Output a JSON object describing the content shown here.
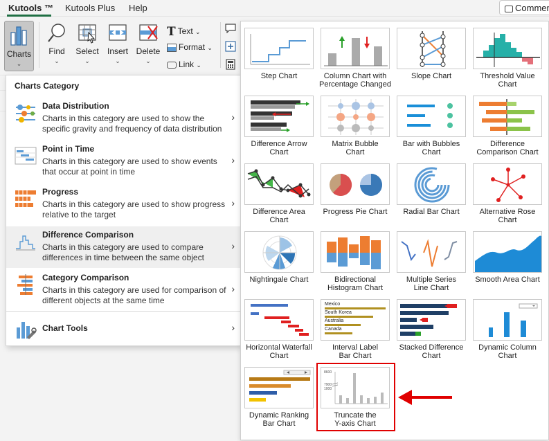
{
  "tabs": {
    "kutools": "Kutools ™",
    "kutools_plus": "Kutools Plus",
    "help": "Help",
    "comments": "Commen"
  },
  "ribbon": {
    "charts": "Charts",
    "find": "Find",
    "select": "Select",
    "insert": "Insert",
    "delete": "Delete",
    "text": "Text",
    "format": "Format",
    "link": "Link"
  },
  "category_menu": {
    "header": "Charts Category",
    "items": [
      {
        "title": "Data Distribution",
        "desc": "Charts in this category are used to show the specific gravity and frequency of data distribution"
      },
      {
        "title": "Point in Time",
        "desc": "Charts in this category are used to show events that occur at point in time"
      },
      {
        "title": "Progress",
        "desc": "Charts in this category are used to show progress relative to the target"
      },
      {
        "title": "Difference Comparison",
        "desc": "Charts in this category are used to compare differences in time between the same object"
      },
      {
        "title": "Category Comparison",
        "desc": "Charts in this category are used for comparison of different objects at the same time"
      },
      {
        "title": "Chart Tools",
        "desc": ""
      }
    ]
  },
  "gallery": {
    "items": [
      "Step Chart",
      "Column Chart with\nPercentage Changed",
      "Slope Chart",
      "Threshold Value\nChart",
      "Difference Arrow\nChart",
      "Matrix Bubble\nChart",
      "Bar with Bubbles\nChart",
      "Difference\nComparison Chart",
      "Difference Area\nChart",
      "Progress Pie Chart",
      "Radial Bar Chart",
      "Alternative Rose\nChart",
      "Nightingale Chart",
      "Bidirectional\nHistogram Chart",
      "Multiple Series\nLine Chart",
      "Smooth Area Chart",
      "Horizontal Waterfall\nChart",
      "Interval Label\nBar Chart",
      "Stacked Difference\nChart",
      "Dynamic Column\nChart",
      "Dynamic Ranking\nBar Chart",
      "Truncate the\nY-axis Chart"
    ],
    "interval_labels": [
      "Mexico",
      "South Korea",
      "Australia",
      "Canada"
    ],
    "truncate_ticks": [
      "8600",
      "7900",
      "1000"
    ]
  },
  "colors": {
    "accent_green": "#1f6f43",
    "highlight_red": "#e00000"
  }
}
